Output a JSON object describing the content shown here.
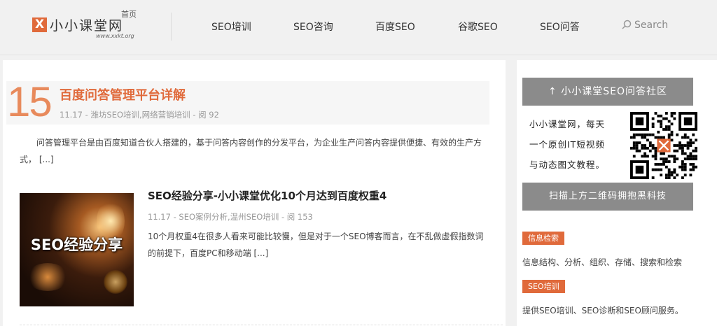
{
  "header": {
    "logo_mark": "X",
    "logo_text": "小小课堂网",
    "logo_home": "首页",
    "logo_url": "www.xxkt.org",
    "nav": [
      "SEO培训",
      "SEO咨询",
      "百度SEO",
      "谷歌SEO",
      "SEO问答"
    ],
    "search_label": "Search"
  },
  "posts": [
    {
      "day": "15",
      "title": "百度问答管理平台详解",
      "date": "11.17",
      "categories": "潍坊SEO培训,网络营销培训",
      "views": "阅 92",
      "excerpt": "问答管理平台是由百度知道合伙人搭建的，基于问答内容创作的分发平台，为企业生产问答内容提供便捷、有效的生产方式，",
      "more": "[...]"
    },
    {
      "title": "SEO经验分享-小小课堂优化10个月达到百度权重4",
      "thumb_caption": "SEO经验分享",
      "date": "11.17",
      "categories": "SEO案例分析,温州SEO培训",
      "views": "阅 153",
      "excerpt": "10个月权重4在很多人看来可能比较慢，但是对于一个SEO博客而言，在不乱做虚假指数词的前提下，百度PC和移动端",
      "more": "[...]"
    }
  ],
  "sidebar": {
    "qr_title": "↑ 小小课堂SEO问答社区",
    "qr_lines": [
      "小小课堂网，每天",
      "一个原创IT短视频",
      "与动态图文教程。"
    ],
    "qr_footer": "扫描上方二维码拥抱黑科技",
    "tags": [
      {
        "label": "信息检索",
        "desc": "信息结构、分析、组织、存储、搜索和检索"
      },
      {
        "label": "SEO培训",
        "desc": "提供SEO培训、SEO诊断和SEO顾问服务。"
      }
    ]
  },
  "colors": {
    "accent": "#e06a3b",
    "number": "#e88a5c",
    "qr_header": "#8b8b8b"
  }
}
